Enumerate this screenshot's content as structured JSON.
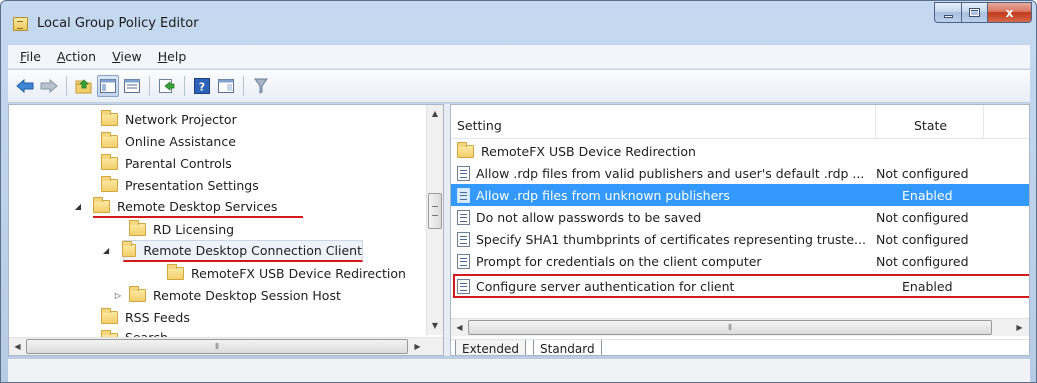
{
  "window": {
    "title": "Local Group Policy Editor",
    "controls": {
      "minimize": "minimize",
      "maximize": "maximize",
      "close": "x"
    }
  },
  "menu": [
    {
      "label": "File",
      "accel": "F",
      "rest": "ile"
    },
    {
      "label": "Action",
      "accel": "A",
      "rest": "ction"
    },
    {
      "label": "View",
      "accel": "V",
      "rest": "iew"
    },
    {
      "label": "Help",
      "accel": "H",
      "rest": "elp"
    }
  ],
  "toolbar": {
    "icons": [
      "back-arrow-icon",
      "forward-arrow-icon",
      "up-folder-icon",
      "show-hide-tree-icon",
      "export-list-icon",
      "help-icon",
      "view-icon",
      "filter-icon"
    ]
  },
  "tree": {
    "items": [
      {
        "label": "Network Projector",
        "level": 2,
        "expander": ""
      },
      {
        "label": "Online Assistance",
        "level": 2,
        "expander": ""
      },
      {
        "label": "Parental Controls",
        "level": 2,
        "expander": ""
      },
      {
        "label": "Presentation Settings",
        "level": 2,
        "expander": ""
      },
      {
        "label": "Remote Desktop Services",
        "level": 2,
        "expander": "◢",
        "highlighted": true
      },
      {
        "label": "RD Licensing",
        "level": 3,
        "expander": ""
      },
      {
        "label": "Remote Desktop Connection Client",
        "level": 3,
        "expander": "◢",
        "highlighted": true,
        "boxed": true
      },
      {
        "label": "RemoteFX USB Device Redirection",
        "level": 4,
        "expander": ""
      },
      {
        "label": "Remote Desktop Session Host",
        "level": 3,
        "expander": "▷"
      },
      {
        "label": "RSS Feeds",
        "level": 2,
        "expander": ""
      },
      {
        "label": "Search",
        "level": 2,
        "expander": ""
      }
    ]
  },
  "list": {
    "columns": {
      "setting": "Setting",
      "state": "State"
    },
    "rows": [
      {
        "setting": "RemoteFX USB Device Redirection",
        "state": "",
        "type": "folder"
      },
      {
        "setting": "Allow .rdp files from valid publishers and user's default .rdp ...",
        "state": "Not configured",
        "type": "policy"
      },
      {
        "setting": "Allow .rdp files from unknown publishers",
        "state": "Enabled",
        "type": "policy",
        "selected": true
      },
      {
        "setting": "Do not allow passwords to be saved",
        "state": "Not configured",
        "type": "policy"
      },
      {
        "setting": "Specify SHA1 thumbprints of certificates representing truste...",
        "state": "Not configured",
        "type": "policy"
      },
      {
        "setting": "Prompt for credentials on the client computer",
        "state": "Not configured",
        "type": "policy"
      },
      {
        "setting": "Configure server authentication for client",
        "state": "Enabled",
        "type": "policy",
        "boxed": true
      }
    ],
    "tabs": [
      "Extended",
      "Standard"
    ],
    "active_tab": "Standard"
  },
  "colors": {
    "selection": "#3399ff",
    "highlight_red": "#d11a1a"
  }
}
